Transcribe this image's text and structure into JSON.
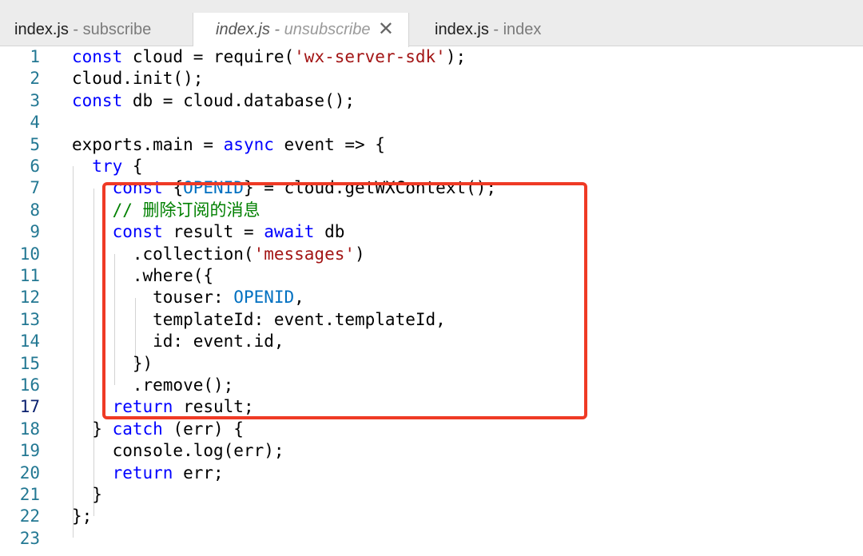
{
  "tabs": [
    {
      "file": "index.js",
      "sep": " - ",
      "desc": "subscribe",
      "active": false
    },
    {
      "file": "index.js",
      "sep": " - ",
      "desc": "unsubscribe",
      "active": true,
      "close": "✕"
    },
    {
      "file": "index.js",
      "sep": " - ",
      "desc": "index",
      "active": false
    }
  ],
  "editor": {
    "active_line": 17,
    "lines": [
      {
        "n": "1",
        "tokens": [
          [
            "kw",
            "const"
          ],
          [
            "p",
            " cloud = require("
          ],
          [
            "str",
            "'wx-server-sdk'"
          ],
          [
            "p",
            ");"
          ]
        ]
      },
      {
        "n": "2",
        "tokens": [
          [
            "p",
            "cloud.init();"
          ]
        ]
      },
      {
        "n": "3",
        "tokens": [
          [
            "kw",
            "const"
          ],
          [
            "p",
            " db = cloud.database();"
          ]
        ]
      },
      {
        "n": "4",
        "tokens": []
      },
      {
        "n": "5",
        "tokens": [
          [
            "p",
            "exports.main = "
          ],
          [
            "kw",
            "async"
          ],
          [
            "p",
            " event => {"
          ]
        ]
      },
      {
        "n": "6",
        "tokens": [
          [
            "p",
            "  "
          ],
          [
            "kw",
            "try"
          ],
          [
            "p",
            " {"
          ]
        ]
      },
      {
        "n": "7",
        "tokens": [
          [
            "p",
            "    "
          ],
          [
            "kw",
            "const"
          ],
          [
            "p",
            " {"
          ],
          [
            "const",
            "OPENID"
          ],
          [
            "p",
            "} = cloud.getWXContext();"
          ]
        ]
      },
      {
        "n": "8",
        "tokens": [
          [
            "p",
            "    "
          ],
          [
            "cmt",
            "// 删除订阅的消息"
          ]
        ]
      },
      {
        "n": "9",
        "tokens": [
          [
            "p",
            "    "
          ],
          [
            "kw",
            "const"
          ],
          [
            "p",
            " result = "
          ],
          [
            "kw",
            "await"
          ],
          [
            "p",
            " db"
          ]
        ]
      },
      {
        "n": "10",
        "tokens": [
          [
            "p",
            "      .collection("
          ],
          [
            "str",
            "'messages'"
          ],
          [
            "p",
            ")"
          ]
        ]
      },
      {
        "n": "11",
        "tokens": [
          [
            "p",
            "      .where({"
          ]
        ]
      },
      {
        "n": "12",
        "tokens": [
          [
            "p",
            "        touser: "
          ],
          [
            "const",
            "OPENID"
          ],
          [
            "p",
            ","
          ]
        ]
      },
      {
        "n": "13",
        "tokens": [
          [
            "p",
            "        templateId: event.templateId,"
          ]
        ]
      },
      {
        "n": "14",
        "tokens": [
          [
            "p",
            "        id: event.id,"
          ]
        ]
      },
      {
        "n": "15",
        "tokens": [
          [
            "p",
            "      })"
          ]
        ]
      },
      {
        "n": "16",
        "tokens": [
          [
            "p",
            "      .remove();"
          ]
        ]
      },
      {
        "n": "17",
        "tokens": [
          [
            "p",
            "    "
          ],
          [
            "kw",
            "return"
          ],
          [
            "p",
            " result;"
          ]
        ]
      },
      {
        "n": "18",
        "tokens": [
          [
            "p",
            "  } "
          ],
          [
            "kw",
            "catch"
          ],
          [
            "p",
            " (err) {"
          ]
        ]
      },
      {
        "n": "19",
        "tokens": [
          [
            "p",
            "    console.log(err);"
          ]
        ]
      },
      {
        "n": "20",
        "tokens": [
          [
            "p",
            "    "
          ],
          [
            "kw",
            "return"
          ],
          [
            "p",
            " err;"
          ]
        ]
      },
      {
        "n": "21",
        "tokens": [
          [
            "p",
            "  }"
          ]
        ]
      },
      {
        "n": "22",
        "tokens": [
          [
            "p",
            "};"
          ]
        ]
      },
      {
        "n": "23",
        "tokens": []
      }
    ]
  },
  "colors": {
    "keyword": "#0000ff",
    "string": "#a31515",
    "comment": "#008000",
    "constant": "#0070c1",
    "line_number": "#237893",
    "highlight_box": "#ef3a25"
  }
}
